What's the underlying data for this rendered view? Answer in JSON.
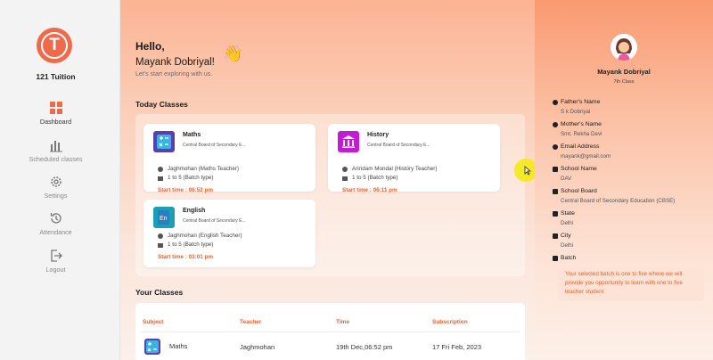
{
  "brand": {
    "name": "121 Tuition",
    "logo_letter": "T",
    "accent": "#ef6a4a"
  },
  "nav": [
    {
      "label": "Dashboard",
      "icon": "grid-icon",
      "active": true
    },
    {
      "label": "Scheduled classes",
      "icon": "bar-chart-icon",
      "active": false
    },
    {
      "label": "Settings",
      "icon": "gear-icon",
      "active": false
    },
    {
      "label": "Attendance",
      "icon": "history-icon",
      "active": false
    },
    {
      "label": "Logout",
      "icon": "logout-icon",
      "active": false
    }
  ],
  "greeting": {
    "hello": "Hello,",
    "name": "Mayank Dobriyal!",
    "wave": "👋",
    "subtitle": "Let's start exploring with us."
  },
  "today": {
    "title": "Today Classes",
    "classes": [
      {
        "subject": "Maths",
        "board": "Central Board of Secondary E...",
        "teacher": "Jaghmohan (Maths Teacher)",
        "batch": "1 to 5 (Batch type)",
        "start": "Start time : 06:52 pm",
        "thumb_color": "#5b3fb0"
      },
      {
        "subject": "History",
        "board": "Central Board of Secondary E...",
        "teacher": "Arindam Mondal (History Teacher)",
        "batch": "1 to 5 (Batch type)",
        "start": "Start time : 06:11 pm",
        "thumb_color": "#c21bd6"
      },
      {
        "subject": "English",
        "board": "Central Board of Secondary E...",
        "teacher": "Jaghmohan (English Teacher)",
        "batch": "1 to 5 (Batch type)",
        "start": "Start time : 03:01 pm",
        "thumb_color": "#1b9fb7"
      }
    ]
  },
  "your_classes": {
    "title": "Your Classes",
    "columns": [
      "Subject",
      "Teacher",
      "Time",
      "Subscription"
    ],
    "rows": [
      {
        "subject": "Maths",
        "teacher": "Jaghmohan",
        "time": "19th Dec,06:52 pm",
        "subscription": "17 Fri Feb, 2023"
      }
    ]
  },
  "profile": {
    "name": "Mayank Dobriyal",
    "class": "7th Class",
    "fields": [
      {
        "label": "Father's Name",
        "value": "S k Dobriyal",
        "icon": "info-icon"
      },
      {
        "label": "Mother's Name",
        "value": "Smt. Rekha Devi",
        "icon": "info-icon"
      },
      {
        "label": "Email Address",
        "value": "mayank@gmail.com",
        "icon": "info-icon"
      },
      {
        "label": "School Name",
        "value": "DAV",
        "icon": "school-icon"
      },
      {
        "label": "School Board",
        "value": "Central Board of Secondary Education (CBSE)",
        "icon": "school-icon"
      },
      {
        "label": "State",
        "value": "Delhi",
        "icon": "building-icon"
      },
      {
        "label": "City",
        "value": "Delhi",
        "icon": "building-icon"
      },
      {
        "label": "Batch",
        "value": "",
        "icon": "building-icon"
      }
    ],
    "batch_note": "Your selected batch is one to five where we will provide you opportunity to learn with one to five teacher student"
  }
}
